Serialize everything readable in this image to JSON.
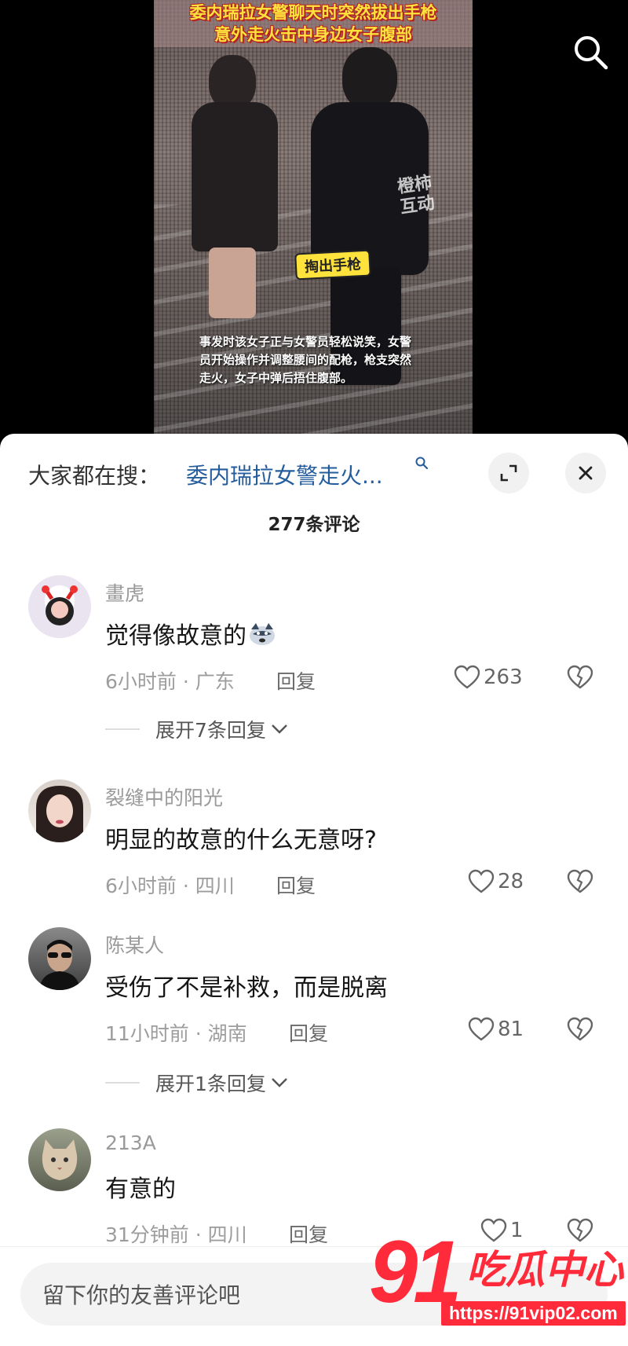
{
  "video": {
    "title_line1": "委内瑞拉女警聊天时突然拔出手枪",
    "title_line2": "意外走火击中身边女子腹部",
    "watermark": "橙柿互动",
    "sticker": "掏出手枪",
    "caption": "事发时该女子正与女警员轻松说笑，女警员开始操作并调整腰间的配枪，枪支突然走火，女子中弹后捂住腹部。"
  },
  "search": {
    "prefix": "大家都在搜：",
    "term": "委内瑞拉女警走火..."
  },
  "comment_count": "277条评论",
  "comments": [
    {
      "user": "畫虎",
      "text": "觉得像故意的",
      "time_location": "6小时前 · 广东",
      "reply": "回复",
      "likes": "263",
      "expand": "展开7条回复"
    },
    {
      "user": "裂缝中的阳光",
      "text": "明显的故意的什么无意呀?",
      "time_location": "6小时前 · 四川",
      "reply": "回复",
      "likes": "28"
    },
    {
      "user": "陈某人",
      "text": "受伤了不是补救，而是脱离",
      "time_location": "11小时前 · 湖南",
      "reply": "回复",
      "likes": "81",
      "expand": "展开1条回复"
    },
    {
      "user": "213A",
      "text": "有意的",
      "time_location": "31分钟前 · 四川",
      "reply": "回复",
      "likes": "1"
    }
  ],
  "input": {
    "placeholder": "留下你的友善评论吧"
  },
  "site_logo": {
    "number": "91",
    "name": "吃瓜中心",
    "url": "https://91vip02.com"
  },
  "colors": {
    "accent_link": "#255c9c",
    "logo_red": "#ff2b3a",
    "title_yellow": "#ffe23c"
  }
}
